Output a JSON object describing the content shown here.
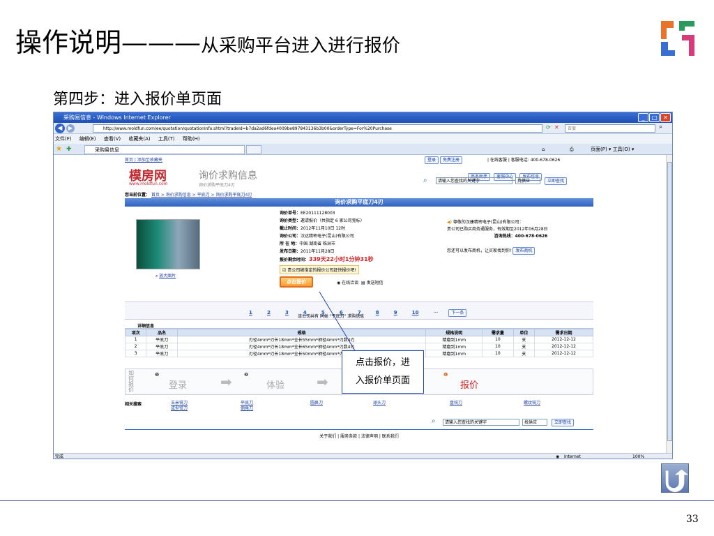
{
  "slide": {
    "title_main": "操作说明———",
    "title_sub": "从采购平台进入进行报价",
    "step": "第四步：进入报价单页面",
    "callout_line1": "点击报价，进",
    "callout_line2": "入报价单页面",
    "page_number": "33"
  },
  "browser": {
    "window_title": "采购易信息 - Windows Internet Explorer",
    "url": "http://www.moldfun.com/ee/quotation/quotationInfo.shtml?tradeId=b7da2ad6fdea4009be897843136b3b00&orderType=For%20Purchase",
    "search_placeholder": "百度",
    "menu": [
      "文件(F)",
      "编辑(E)",
      "查看(V)",
      "收藏夹(A)",
      "工具(T)",
      "帮助(H)"
    ],
    "tab": "采购易信息",
    "toolbar_right": "页面(P) ▾  工具(O) ▾",
    "status_left": "完成",
    "status_zone": "Internet",
    "status_zoom": "100%"
  },
  "site": {
    "top_left": "首页 | 添加至收藏夹",
    "login": "登录",
    "register": "免费注册",
    "top_right": "| 在线客服 | 客服电话: 400-678-0626",
    "logo_text": "模房网",
    "logo_url": "www.moldfun.com",
    "section_title": "询价求购信息",
    "section_sub": "询价求购平底刀4刃",
    "biz_assist": "商务助手",
    "client_center": "客服中心",
    "post_info": "发布信息",
    "search_input": "请输入您查找的关键字",
    "supplier_select": "找供应",
    "search_btn": "立即查找",
    "breadcrumb_label": "您当前位置：",
    "breadcrumb": "首页 > 询价求购信息 > 平底刀 > 询价求购平底刀4刃",
    "banner": "询价求购平底刀4刃",
    "details": [
      {
        "label": "询价单号：",
        "value": "EE20111128003"
      },
      {
        "label": "询价类型：",
        "value": "邀请报价（共指定 6 家公司竞标）"
      },
      {
        "label": "截止时间：",
        "value": "2012年11月10日 12时"
      },
      {
        "label": "询价公司：",
        "value": "汉达精密电子(昆山)有限公司"
      },
      {
        "label": "所 在 地：",
        "value": "中国 湖南省 株洲市"
      },
      {
        "label": "发布日期：",
        "value": "2011年11月28日"
      },
      {
        "label": "报价剩余时间：",
        "value": "339天22小时1分钟31秒"
      }
    ],
    "notice": "贵公司被指定的报价公司赶快报价吧!",
    "quote_btn": "点击报价",
    "online_chat": "在线洽谈",
    "send_sms": "发送短信",
    "enlarge": "放大图片",
    "msg_line1": "尊敬的汉康精密电子(昆山)有限公司：",
    "msg_line2": "贵公司已购买商务通服务，有效期至2012年06月28日",
    "hotline": "咨询热线：400-678-0626",
    "post_prompt": "您还可以发布商机，让买家找到你!",
    "post_biz": "发布商机",
    "pages": [
      "1",
      "2",
      "3",
      "4",
      "5",
      "6",
      "7",
      "8",
      "9",
      "10"
    ],
    "ellipsis": "···",
    "next_page": "下一条",
    "result_line": "该公司共有 同类 \"平底刀\" 求购信息",
    "detail_header": "详细信息",
    "columns": [
      "项次",
      "品名",
      "规格",
      "规格说明",
      "需求量",
      "单位",
      "需求日期"
    ],
    "rows": [
      [
        "1",
        "平底刀",
        "刃径4mm*刃长18mm*全长55mm*柄径4mm*刃数4刃",
        "精磨到1mm",
        "10",
        "支",
        "2012-12-12"
      ],
      [
        "2",
        "平底刀",
        "刃径4mm*刃长18mm*全长65mm*柄径4mm*刃数4刃",
        "精磨到1mm",
        "10",
        "支",
        "2012-12-12"
      ],
      [
        "3",
        "平底刀",
        "刃径4mm*刃长18mm*全长50mm*柄径4mm*刃数4刃",
        "精磨到1mm",
        "10",
        "支",
        "2012-12-12"
      ]
    ],
    "how_quote": "如何报价",
    "steps": [
      "登录",
      "体验",
      "报价"
    ],
    "related_label": "相关搜索",
    "related": [
      "玉米铣刀",
      "平底刀",
      "圆鼻刀",
      "球头刀",
      "盘铣刀",
      "螺纹铣刀",
      "成型铣刀",
      "倒角刀"
    ],
    "footer": "关于我们 | 服务条款 | 法律声明 | 联系我们"
  }
}
